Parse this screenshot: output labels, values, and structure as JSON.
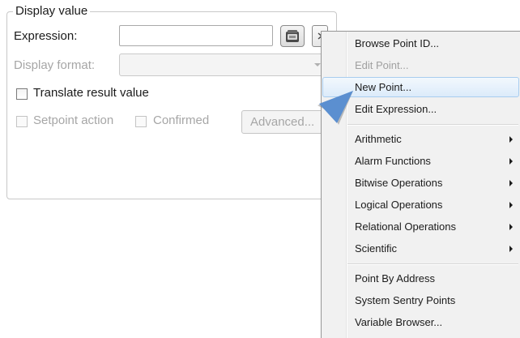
{
  "group": {
    "title": "Display value"
  },
  "form": {
    "expression_label": "Expression:",
    "expression_value": "",
    "display_format_label": "Display format:",
    "display_format_value": "",
    "translate_label": "Translate result value",
    "setpoint_label": "Setpoint action",
    "confirmed_label": "Confirmed",
    "advanced_label": "Advanced..."
  },
  "icons": {
    "point_browser": "point-browser-icon",
    "menu_button": "dropdown-button-icon",
    "pointer": "callout-arrow-icon"
  },
  "menu": {
    "items": [
      {
        "label": "Browse Point ID...",
        "enabled": true
      },
      {
        "label": "Edit Point...",
        "enabled": false
      },
      {
        "label": "New Point...",
        "enabled": true,
        "highlighted": true
      },
      {
        "label": "Edit Expression...",
        "enabled": true
      },
      {
        "label": "Arithmetic",
        "submenu": true
      },
      {
        "label": "Alarm Functions",
        "submenu": true
      },
      {
        "label": "Bitwise Operations",
        "submenu": true
      },
      {
        "label": "Logical Operations",
        "submenu": true
      },
      {
        "label": "Relational Operations",
        "submenu": true
      },
      {
        "label": "Scientific",
        "submenu": true
      },
      {
        "label": "Point By Address"
      },
      {
        "label": "System Sentry Points"
      },
      {
        "label": "Variable Browser..."
      }
    ]
  },
  "colors": {
    "menu_background": "#f1f1f1",
    "highlight_border": "#a8cdef",
    "pointer": "#5b8fd0",
    "disabled_text": "#a6a6a6"
  }
}
